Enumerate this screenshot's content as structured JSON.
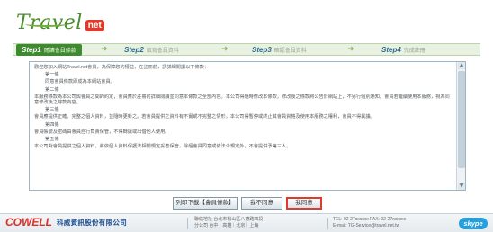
{
  "logo": {
    "text": "Travel",
    "badge": "net"
  },
  "steps": [
    {
      "num": "Step1",
      "label": "閱讀會員條款"
    },
    {
      "num": "Step2",
      "label": "填寫會員資料"
    },
    {
      "num": "Step3",
      "label": "確認會員資料"
    },
    {
      "num": "Step4",
      "label": "完成註冊"
    }
  ],
  "terms": {
    "intro": "歡迎您加入網站Travel.net會員，為保障您的權益，在註冊前，請詳細閱讀以下條款：",
    "sections": [
      {
        "title": "第一條",
        "body": "同意會員條款即成為本網站會員。"
      },
      {
        "title": "第二條",
        "body": "本服務條款為本公司與會員之間的約定，會員應於註冊前詳細閱讀並同意本條款之全部內容。本公司得隨時修改本條款，修改後之條款將公告於網站上，不另行個別通知。會員若繼續使用本服務，視為同意修改後之條款內容。"
      },
      {
        "title": "第三條",
        "body": "會員應提供正確、完整之個人資料，並隨時更新之。若會員提供之資料有不實或不完整之情形，本公司得暫停或終止其會員資格及使用本服務之權利，會員不得異議。"
      },
      {
        "title": "第四條",
        "body": "會員帳號及密碼由會員自行負責保管，不得轉讓或出借他人使用。"
      },
      {
        "title": "第五條",
        "body": "本公司對會員提供之個人資料，將依個人資料保護法相關規定妥善保管，除經會員同意或依法令規定外，不會提供予第三人。"
      }
    ]
  },
  "buttons": {
    "print": "列印下載【會員條款】",
    "disagree": "我不同意",
    "agree": "我同意"
  },
  "footer": {
    "brand": "COWELL",
    "company": "科威資訊股份有限公司",
    "addr_label_1": "聯絡地址",
    "addr_1": "台北市松山區八德路四段",
    "addr_label_2": "分公司",
    "addr_2": "台中｜高雄｜北京｜上海",
    "tel": "TEL: 02-27xxxxxx  FAX: 02-27xxxxxx",
    "email": "E-mail: TG-Service@travel.net.tw",
    "skype": "skype"
  }
}
